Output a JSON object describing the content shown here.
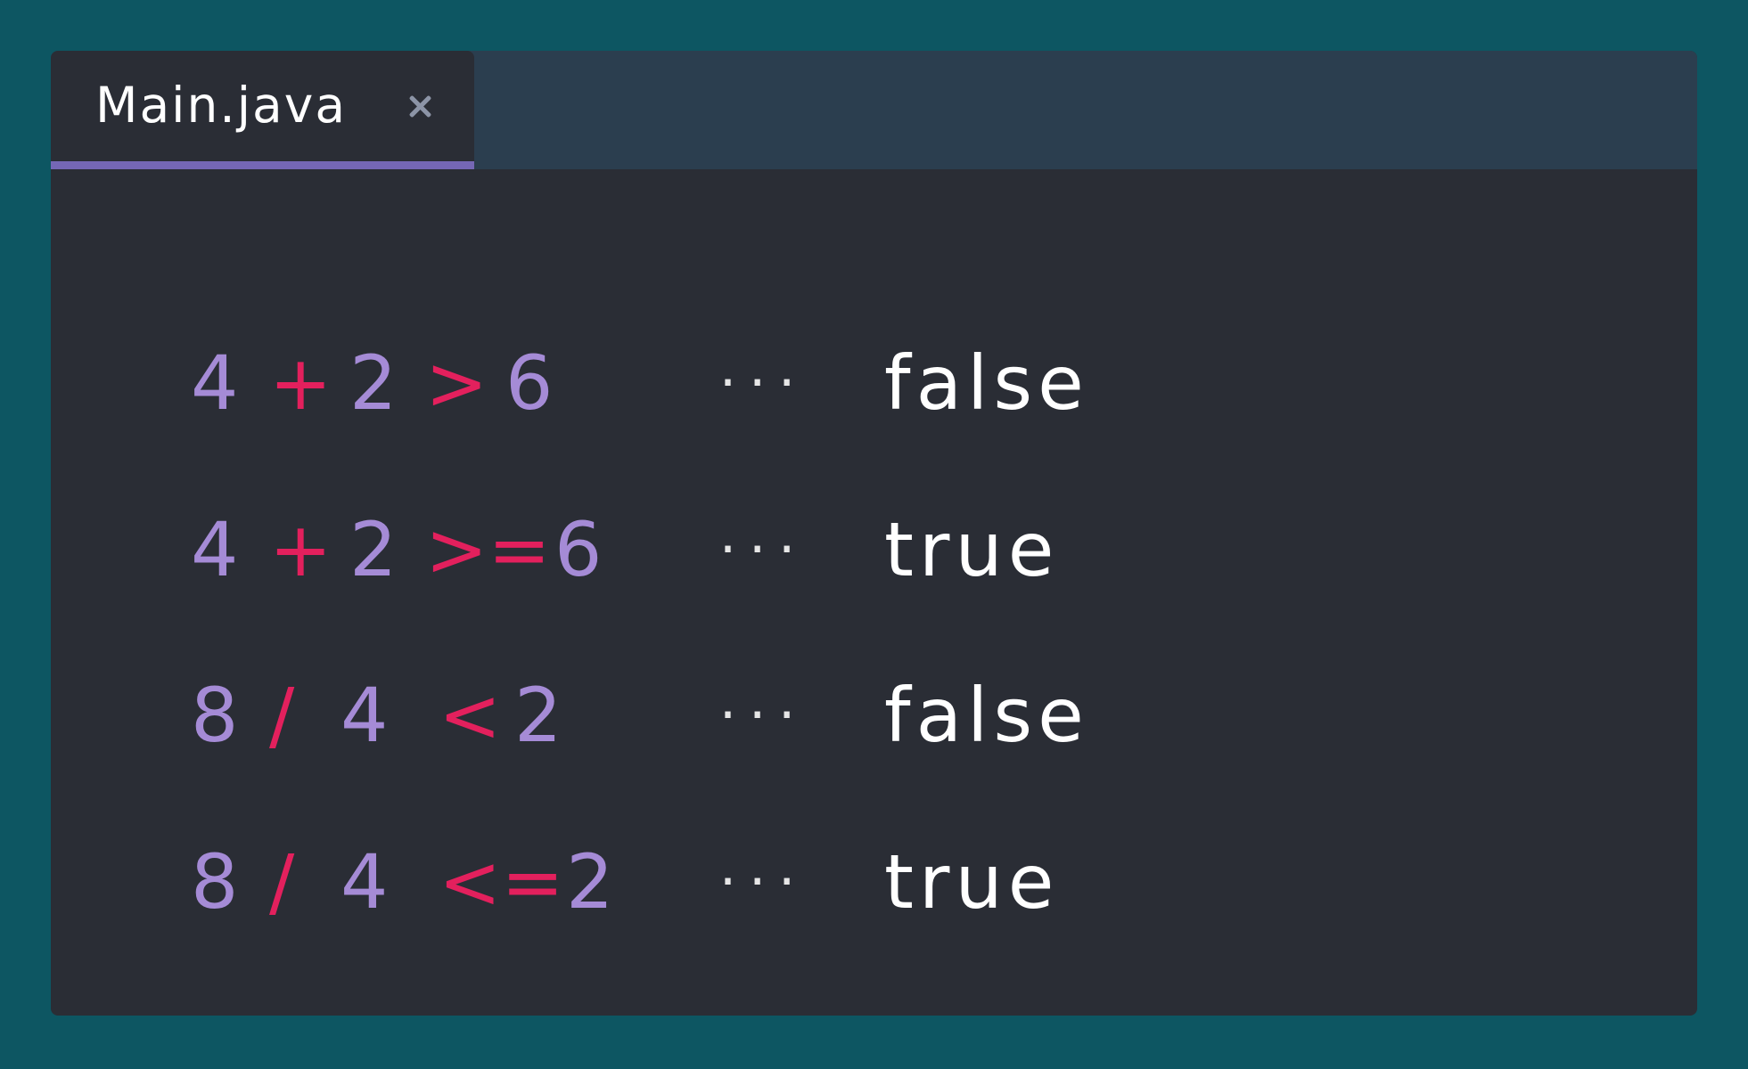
{
  "tab": {
    "title": "Main.java"
  },
  "lines": [
    {
      "tokens": [
        "4",
        "+",
        "2",
        ">",
        "6"
      ],
      "ellipsis": "···",
      "result": "false"
    },
    {
      "tokens": [
        "4",
        "+",
        "2",
        ">=",
        "6"
      ],
      "ellipsis": "···",
      "result": "true"
    },
    {
      "tokens": [
        "8",
        "/",
        "4",
        "<",
        "2"
      ],
      "ellipsis": "···",
      "result": "false"
    },
    {
      "tokens": [
        "8",
        "/",
        "4",
        "<=",
        "2"
      ],
      "ellipsis": "···",
      "result": "true"
    }
  ],
  "colors": {
    "background": "#0d5662",
    "editor": "#2a2d35",
    "tabbar": "#2b3e4f",
    "accent": "#7567b5",
    "number": "#a58bd6",
    "operator": "#e3205d",
    "text": "#ffffff"
  },
  "icons": {
    "tab_close": "close-icon"
  }
}
